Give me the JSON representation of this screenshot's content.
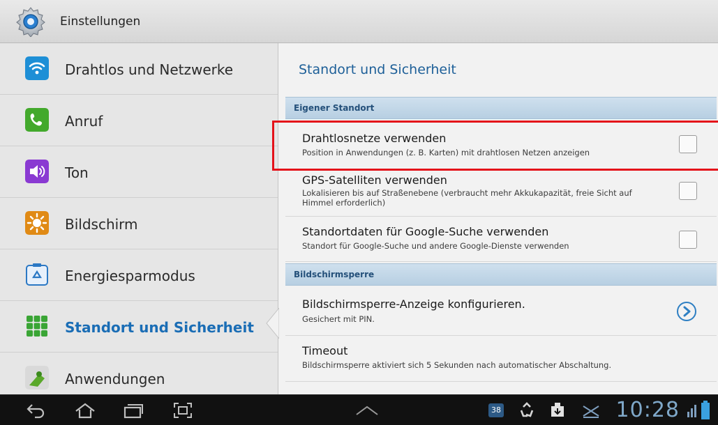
{
  "titlebar": {
    "title": "Einstellungen",
    "icon": "settings-gear-icon"
  },
  "sidebar": {
    "items": [
      {
        "label": "Drahtlos und Netzwerke",
        "icon": "wifi-icon",
        "color": "#1e8fd6"
      },
      {
        "label": "Anruf",
        "icon": "phone-icon",
        "color": "#43a92c"
      },
      {
        "label": "Ton",
        "icon": "speaker-icon",
        "color": "#8a3ad2"
      },
      {
        "label": "Bildschirm",
        "icon": "brightness-icon",
        "color": "#e08a15"
      },
      {
        "label": "Energiesparmodus",
        "icon": "recycle-icon",
        "color": "#2b78c4"
      },
      {
        "label": "Standort und Sicherheit",
        "icon": "location-grid-icon",
        "color": "#3aa535",
        "active": true
      },
      {
        "label": "Anwendungen",
        "icon": "android-icon",
        "color": "#5aa82a"
      }
    ]
  },
  "main": {
    "title": "Standort und Sicherheit",
    "sections": [
      {
        "header": "Eigener Standort",
        "rows": [
          {
            "title": "Drahtlosnetze verwenden",
            "subtitle": "Position in Anwendungen (z. B. Karten) mit drahtlosen Netzen anzeigen",
            "control": "checkbox",
            "checked": false
          },
          {
            "title": "GPS-Satelliten verwenden",
            "subtitle": "Lokalisieren bis auf Straßenebene (verbraucht mehr Akkukapazität, freie Sicht auf Himmel erforderlich)",
            "control": "checkbox",
            "checked": false
          },
          {
            "title": "Standortdaten für Google-Suche verwenden",
            "subtitle": "Standort für Google-Suche und andere Google-Dienste verwenden",
            "control": "checkbox",
            "checked": false
          }
        ]
      },
      {
        "header": "Bildschirmsperre",
        "rows": [
          {
            "title": "Bildschirmsperre-Anzeige konfigurieren.",
            "subtitle": "Gesichert mit PIN.",
            "control": "chevron"
          },
          {
            "title": "Timeout",
            "subtitle": "Bildschirmsperre aktiviert sich 5 Sekunden nach automatischer Abschaltung."
          }
        ]
      }
    ]
  },
  "navbar": {
    "buttons": [
      "back-icon",
      "home-icon",
      "recent-apps-icon",
      "screenshot-icon",
      "up-arrow-icon"
    ],
    "status_icons": [
      "calendar-icon",
      "recycle-icon",
      "download-icon",
      "no-sim-icon"
    ],
    "badge": "38",
    "clock": "10:28"
  },
  "colors": {
    "accent": "#1a6db5",
    "highlight": "#e4121a"
  }
}
